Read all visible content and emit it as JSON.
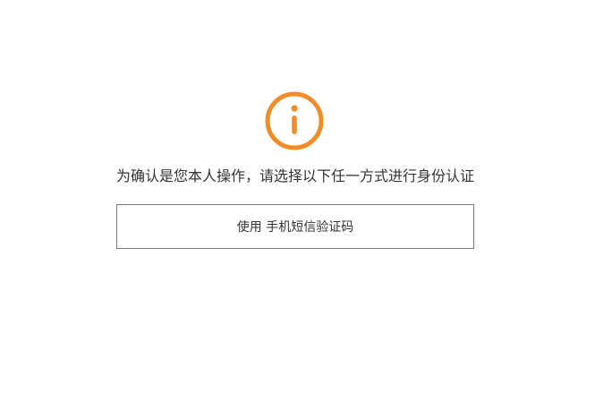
{
  "colors": {
    "accent": "#f28c28",
    "text": "#333333",
    "border": "#7a7a7a",
    "background": "#ffffff"
  },
  "icon": {
    "name": "info-icon"
  },
  "prompt": {
    "text": "为确认是您本人操作，请选择以下任一方式进行身份认证"
  },
  "options": [
    {
      "label": "使用 手机短信验证码"
    }
  ]
}
